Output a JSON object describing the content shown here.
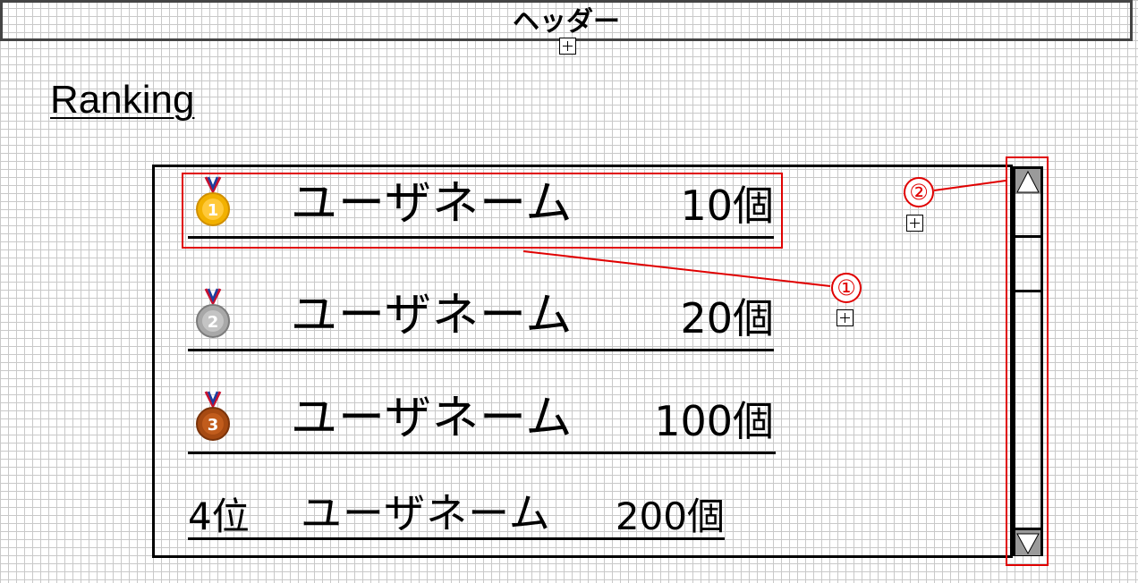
{
  "header": {
    "title": "ヘッダー"
  },
  "page": {
    "title": "Ranking"
  },
  "ranking": {
    "rows": [
      {
        "rank": 1,
        "medal": "gold-medal-icon",
        "name": "ユーザネーム",
        "count": "10個"
      },
      {
        "rank": 2,
        "medal": "silver-medal-icon",
        "name": "ユーザネーム",
        "count": "20個"
      },
      {
        "rank": 3,
        "medal": "bronze-medal-icon",
        "name": "ユーザネーム",
        "count": "100個"
      },
      {
        "rank": 4,
        "rank_label": "4位",
        "name": "ユーザネーム",
        "count": "200個"
      }
    ]
  },
  "annotations": {
    "callout_1": "①",
    "callout_2": "②"
  },
  "colors": {
    "annotation": "#e00000",
    "gold": "#f2b100",
    "silver": "#a8a8a8",
    "bronze": "#a64a12",
    "grid": "#c9c9c9"
  }
}
